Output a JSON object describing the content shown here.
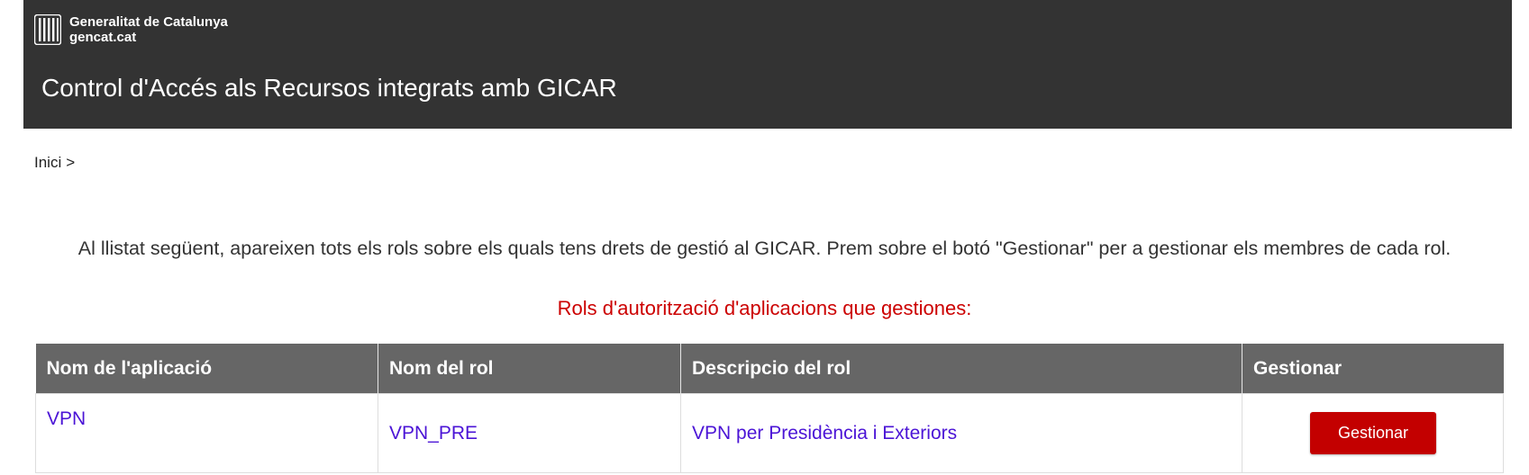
{
  "header": {
    "brand_line1": "Generalitat de Catalunya",
    "brand_line2": "gencat.cat",
    "logo_icon": "generalitat-logo-icon",
    "title": "Control d'Accés als Recursos integrats amb GICAR",
    "background_color": "#333333"
  },
  "breadcrumb": {
    "home": "Inici",
    "separator": ">"
  },
  "intro_text": "Al llistat següent, apareixen tots els rols sobre els quals tens drets de gestió al GICAR. Prem sobre el botó \"Gestionar\" per a gestionar els membres de cada rol.",
  "section_title": "Rols d'autorització d'aplicacions que gestiones:",
  "table": {
    "headers": [
      "Nom de l'aplicació",
      "Nom del rol",
      "Descripcio del rol",
      "Gestionar"
    ],
    "rows": [
      {
        "app_name": "VPN",
        "role_name": "VPN_PRE",
        "role_description": "VPN per Presidència i Exteriors",
        "manage_label": "Gestionar"
      }
    ]
  },
  "colors": {
    "accent_red": "#c30000",
    "section_title_red": "#cc0000",
    "link_color": "#4b14d6",
    "table_header_bg": "#666666"
  }
}
